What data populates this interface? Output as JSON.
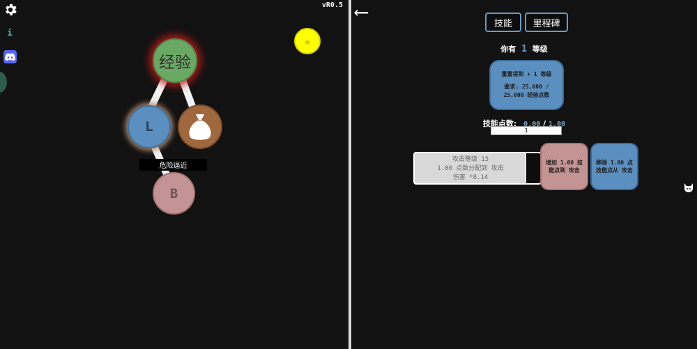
{
  "version": "vR0.5",
  "tree": {
    "exp_node": "经验",
    "l_node": "L",
    "b_node": "B",
    "danger_label": "危险逼近"
  },
  "icons": {
    "settings": "gear-icon",
    "info": "info-icon",
    "discord": "discord-icon",
    "star": "star-icon",
    "bag": "money-bag-icon",
    "back": "arrow-left-icon",
    "cat": "cat-icon"
  },
  "info_label": "i",
  "back_label": "⟵",
  "tabs": {
    "skills": "技能",
    "milestones": "里程碑"
  },
  "level": {
    "prefix": "你有",
    "value": "1",
    "suffix": "等级"
  },
  "reset": {
    "line1": "重置得到 + 1 等级",
    "line2": "要求: 25,000 / 25,000 经验点数"
  },
  "skill_points": {
    "label": "技能点数:",
    "current": "0.00",
    "sep": "/",
    "max": "1.00"
  },
  "input_value": "1",
  "attack": {
    "line1": "攻击等级 15",
    "line2": "1.00 点数分配到 攻击",
    "line3": "伤害 *8.14"
  },
  "add_button": "增加 1.00 技能点到 攻击",
  "remove_button": "移除 1.00 点技能点从 攻击",
  "colors": {
    "background": "#121212",
    "exp_green": "#6aa964",
    "blue": "#5a8fc0",
    "pink": "#c49393",
    "brown": "#a0683d",
    "star_yellow": "#ffff00"
  }
}
